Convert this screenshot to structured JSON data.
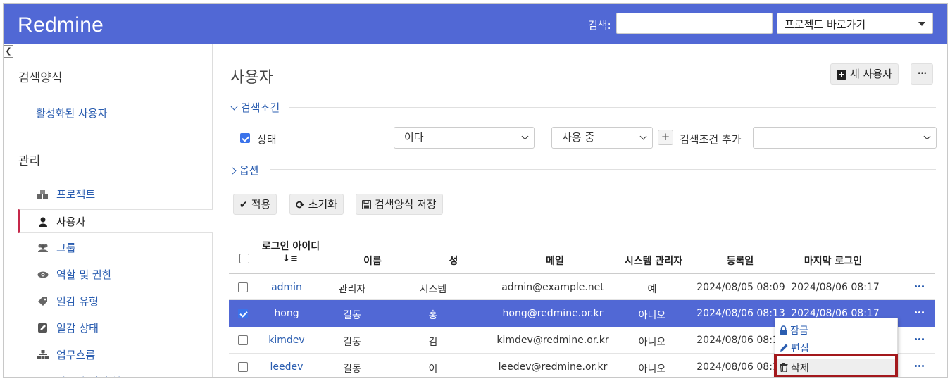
{
  "header": {
    "app_title": "Redmine",
    "search_label": "검색:",
    "search_value": "",
    "jump_select": "프로젝트 바로가기"
  },
  "sidebar": {
    "queries_heading": "검색양식",
    "query_link": "활성화된 사용자",
    "admin_heading": "관리",
    "items": [
      {
        "label": "프로젝트",
        "icon": "projects-icon"
      },
      {
        "label": "사용자",
        "icon": "user-icon",
        "selected": true
      },
      {
        "label": "그룹",
        "icon": "group-icon"
      },
      {
        "label": "역할 및 권한",
        "icon": "eye-icon"
      },
      {
        "label": "일감 유형",
        "icon": "tag-icon"
      },
      {
        "label": "일감 상태",
        "icon": "edit-square-icon"
      },
      {
        "label": "업무흐름",
        "icon": "workflow-icon"
      },
      {
        "label": "사용자 정의 항목",
        "icon": "custom-field-icon"
      }
    ]
  },
  "main": {
    "title": "사용자",
    "new_user_button": "새 사용자",
    "more_button": "•••",
    "filters_title": "검색조건",
    "filter_status_label": "상태",
    "filter_operator": "이다",
    "filter_value": "사용 중",
    "add_filter_label": "검색조건 추가",
    "add_filter_value": "",
    "options_title": "옵션",
    "apply_button": "적용",
    "reset_button": "초기화",
    "save_query_button": "검색양식 저장"
  },
  "table": {
    "columns": [
      "로그인 아이디",
      "이름",
      "성",
      "메일",
      "시스템 관리자",
      "등록일",
      "마지막 로그인"
    ],
    "sort_indicator": "↓≡",
    "rows": [
      {
        "login": "admin",
        "firstname": "관리자",
        "lastname": "시스템",
        "mail": "admin@example.net",
        "admin": "예",
        "created": "2024/08/05 08:09",
        "last_login": "2024/08/06 08:17",
        "checked": false
      },
      {
        "login": "hong",
        "firstname": "길동",
        "lastname": "홍",
        "mail": "hong@redmine.or.kr",
        "admin": "아니오",
        "created": "2024/08/06 08:13",
        "last_login": "2024/08/06 08:17",
        "checked": true
      },
      {
        "login": "kimdev",
        "firstname": "길동",
        "lastname": "김",
        "mail": "kimdev@redmine.or.kr",
        "admin": "아니오",
        "created": "2024/08/06 08:14",
        "last_login": "",
        "checked": false
      },
      {
        "login": "leedev",
        "firstname": "길동",
        "lastname": "이",
        "mail": "leedev@redmine.or.kr",
        "admin": "아니오",
        "created": "2024/08/06 08:15",
        "last_login": "",
        "checked": false
      }
    ]
  },
  "context_menu": {
    "items": [
      {
        "label": "잠금",
        "icon": "lock-icon"
      },
      {
        "label": "편집",
        "icon": "pencil-icon"
      },
      {
        "label": "삭제",
        "icon": "trash-icon"
      }
    ]
  },
  "colors": {
    "header_bg": "#5168d5",
    "link": "#2a5db0",
    "selected_row": "#5168d5",
    "highlight_box": "#a3181c"
  }
}
